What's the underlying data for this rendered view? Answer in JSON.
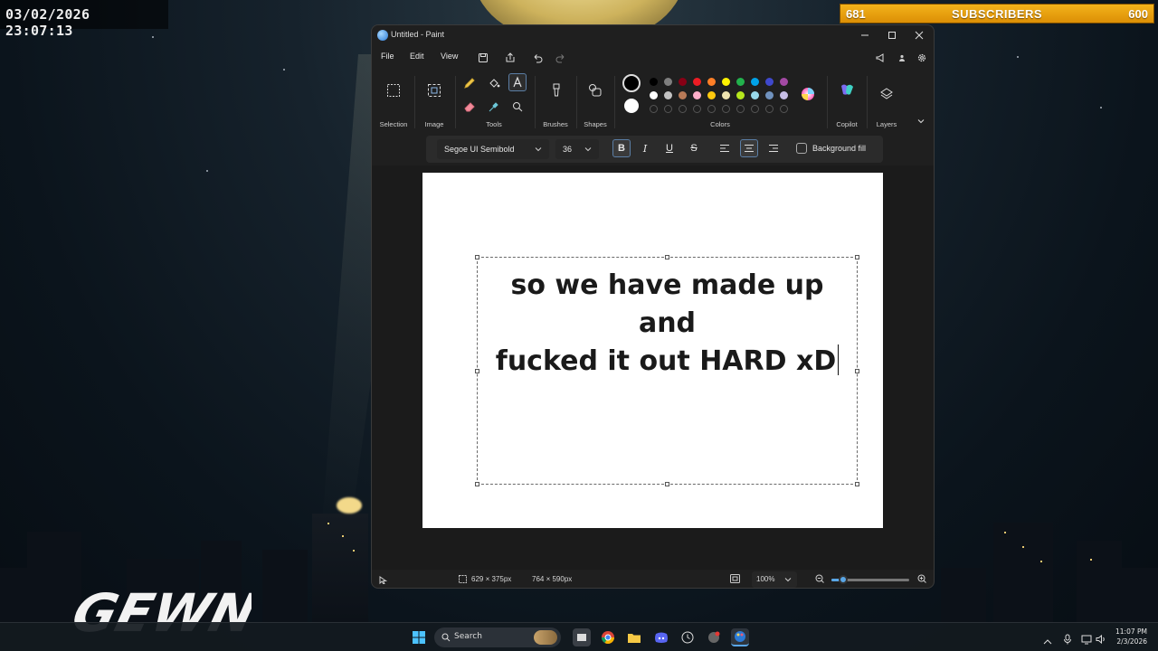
{
  "overlay": {
    "clock": "03/02/2026 23:07:13",
    "subscribers": {
      "left_count": "681",
      "title": "SUBSCRIBERS",
      "right_count": "600"
    },
    "logo_text": "GEWN"
  },
  "window": {
    "title": "Untitled - Paint",
    "controls": [
      "minimize-icon",
      "maximize-icon",
      "close-icon"
    ]
  },
  "menu": {
    "items": [
      "File",
      "Edit",
      "View"
    ],
    "icons": [
      "save-icon",
      "share-icon",
      "undo-icon",
      "redo-icon"
    ],
    "right_icons": [
      "feedback-icon",
      "account-icon",
      "settings-icon"
    ]
  },
  "ribbon": {
    "groups": [
      "Selection",
      "Image",
      "Tools",
      "Brushes",
      "Shapes",
      "Colors",
      "Copilot",
      "Layers"
    ],
    "palette": {
      "primary": "#000000",
      "secondary": "#ffffff",
      "row1": [
        "#000000",
        "#7f7f7f",
        "#880015",
        "#ed1c24",
        "#ff7f27",
        "#fff200",
        "#22b14c",
        "#00a2e8",
        "#3f48cc",
        "#a349a4"
      ],
      "row2": [
        "#ffffff",
        "#c3c3c3",
        "#b97a57",
        "#ffaec9",
        "#ffc90e",
        "#efe4b0",
        "#b5e61d",
        "#99d9ea",
        "#7092be",
        "#c8bfe7"
      ],
      "row3_empty": 10
    }
  },
  "text_toolbar": {
    "font": "Segoe UI Semibold",
    "size": "36",
    "bold": "B",
    "italic": "I",
    "underline": "U",
    "strike": "S",
    "background_fill": "Background fill"
  },
  "canvas": {
    "text_line1": "so we have made up and",
    "text_line2": "fucked it out HARD xD"
  },
  "status": {
    "selection_size": "629 × 375px",
    "canvas_size": "764 × 590px",
    "zoom": "100%",
    "zoom_level": 0.15
  },
  "taskbar": {
    "search_placeholder": "Search",
    "time": "11:07 PM",
    "date": "2/3/2026"
  }
}
